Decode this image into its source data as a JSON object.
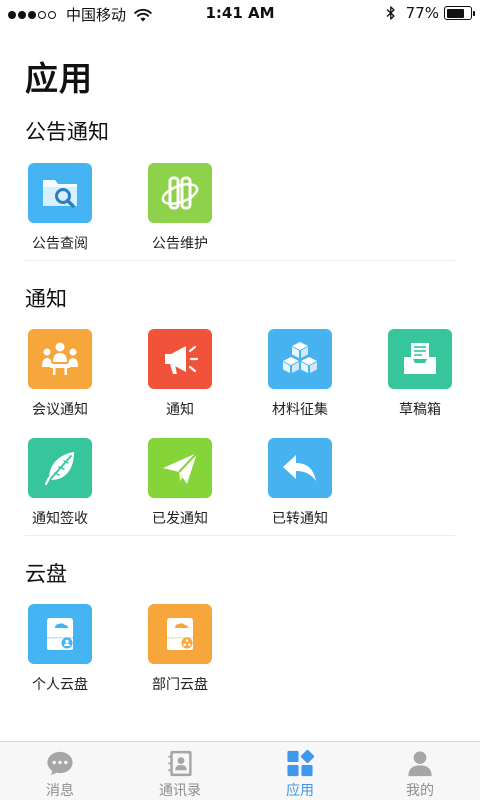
{
  "status_bar": {
    "carrier": "中国移动",
    "time": "1:41 AM",
    "battery_percent": "77%",
    "battery_level": 0.77,
    "signal_bars_filled": 3,
    "signal_bars_total": 5
  },
  "page": {
    "title": "应用"
  },
  "sections": {
    "announcements": {
      "title": "公告通知",
      "apps": [
        {
          "label": "公告查阅",
          "icon": "folder-search-icon",
          "color": "#45b4f2"
        },
        {
          "label": "公告维护",
          "icon": "maintenance-icon",
          "color": "#8dd24a"
        }
      ]
    },
    "notices": {
      "title": "通知",
      "apps": [
        {
          "label": "会议通知",
          "icon": "meeting-icon",
          "color": "#f6a63b"
        },
        {
          "label": "通知",
          "icon": "megaphone-icon",
          "color": "#f0523a"
        },
        {
          "label": "材料征集",
          "icon": "boxes-icon",
          "color": "#46b2f0"
        },
        {
          "label": "草稿箱",
          "icon": "inbox-tray-icon",
          "color": "#37c59c"
        },
        {
          "label": "通知签收",
          "icon": "feather-icon",
          "color": "#37c59c"
        },
        {
          "label": "已发通知",
          "icon": "paper-plane-icon",
          "color": "#84d43a"
        },
        {
          "label": "已转通知",
          "icon": "forward-arrow-icon",
          "color": "#46b2f0"
        }
      ]
    },
    "cloud": {
      "title": "云盘",
      "apps": [
        {
          "label": "个人云盘",
          "icon": "personal-drive-icon",
          "color": "#45b4f2"
        },
        {
          "label": "部门云盘",
          "icon": "department-drive-icon",
          "color": "#f6a63b"
        }
      ]
    }
  },
  "tab_bar": {
    "tabs": [
      {
        "label": "消息",
        "icon": "chat-bubble-icon",
        "active": false
      },
      {
        "label": "通讯录",
        "icon": "contacts-book-icon",
        "active": false
      },
      {
        "label": "应用",
        "icon": "apps-grid-icon",
        "active": true
      },
      {
        "label": "我的",
        "icon": "person-icon",
        "active": false
      }
    ],
    "active_color": "#3d98ee",
    "inactive_color": "#a6a6a6"
  }
}
